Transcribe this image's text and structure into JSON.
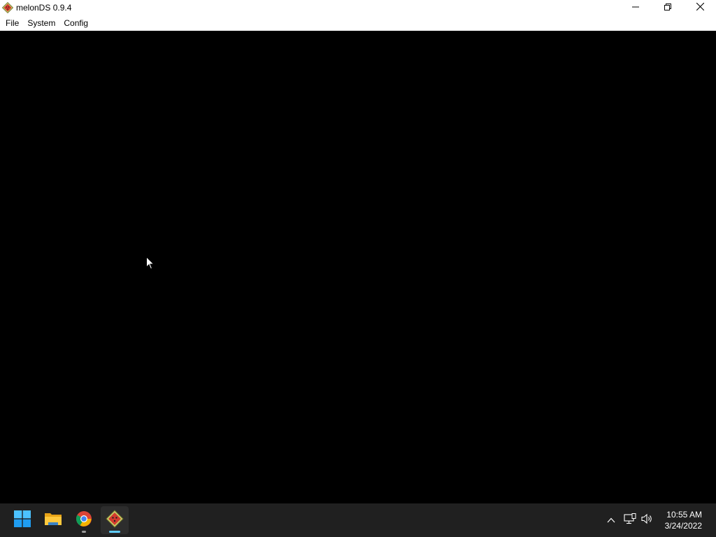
{
  "window": {
    "title": "melonDS 0.9.4",
    "icon": "melonds-icon",
    "controls": [
      "minimize-icon",
      "restore-icon",
      "close-icon"
    ]
  },
  "menu": {
    "file": "File",
    "system": "System",
    "config": "Config"
  },
  "taskbar": {
    "apps": [
      {
        "name": "start",
        "icon": "windows-start-icon"
      },
      {
        "name": "file-explorer",
        "icon": "folder-icon"
      },
      {
        "name": "chrome",
        "icon": "chrome-icon"
      },
      {
        "name": "melonds",
        "icon": "melonds-icon",
        "active": true
      }
    ],
    "tray": [
      "chevron-up-icon",
      "network-icon",
      "volume-icon"
    ],
    "clock": {
      "time": "10:55 AM",
      "date": "3/24/2022"
    }
  },
  "colors": {
    "titlebar": "#ffffff",
    "display": "#000000",
    "taskbar": "#202020",
    "accent": "#60cdff"
  }
}
